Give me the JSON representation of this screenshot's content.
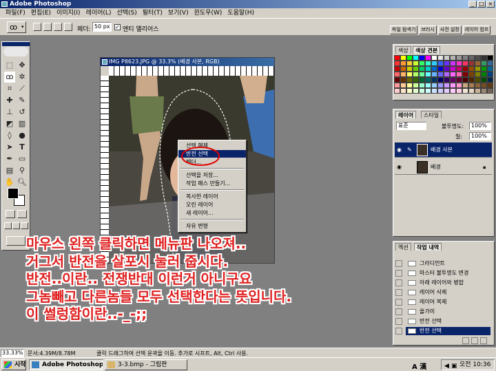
{
  "app": {
    "title": "Adobe Photoshop",
    "window_buttons": [
      "_",
      "□",
      "×"
    ]
  },
  "menubar": [
    "파일(F)",
    "편집(E)",
    "이미지(I)",
    "레이어(L)",
    "선택(S)",
    "필터(T)",
    "보기(V)",
    "윈도우(W)",
    "도움말(H)"
  ],
  "options_bar": {
    "feather_label": "페더:",
    "feather_value": "50 px",
    "antialias_label": "앤티 앨리어스",
    "antialias_checked": "✓",
    "palette_well_tabs": [
      "파일 탐색기",
      "브러시",
      "사전 설정",
      "레이어 컴프"
    ]
  },
  "document": {
    "title": "IMG P8623.JPG @ 33.3% (배경 사본, RGB)"
  },
  "context_menu": {
    "items": [
      "선택 해제",
      "반전 선택",
      "페더...",
      "선택을 저장...",
      "작업 패스 만들기...",
      "복사한 레이어",
      "오린 레이어",
      "새 레이어...",
      "자유 변형"
    ],
    "highlighted": "반전 선택"
  },
  "color_panel": {
    "tabs": [
      "색상",
      "색상 견본"
    ]
  },
  "swatch_colors": [
    "#ff0000",
    "#ffff00",
    "#00ff00",
    "#00ffff",
    "#0000ff",
    "#ff00ff",
    "#ffffff",
    "#e6e6e6",
    "#cccccc",
    "#b3b3b3",
    "#999999",
    "#808080",
    "#666666",
    "#4d4d4d",
    "#333333",
    "#000000",
    "#ff3333",
    "#ff9933",
    "#ffcc33",
    "#ccff33",
    "#33ff66",
    "#33ffcc",
    "#33ccff",
    "#3366ff",
    "#6633ff",
    "#cc33ff",
    "#ff33cc",
    "#ff3366",
    "#993333",
    "#996633",
    "#339966",
    "#336699",
    "#cc0000",
    "#cc6600",
    "#cccc00",
    "#66cc00",
    "#00cc66",
    "#00cccc",
    "#0066cc",
    "#0000cc",
    "#6600cc",
    "#cc00cc",
    "#cc0066",
    "#990000",
    "#994d00",
    "#999900",
    "#009900",
    "#006699",
    "#ff6666",
    "#ffb366",
    "#ffff66",
    "#b3ff66",
    "#66ff99",
    "#66ffff",
    "#66b3ff",
    "#6666ff",
    "#b366ff",
    "#ff66ff",
    "#ff66b3",
    "#800000",
    "#804000",
    "#808000",
    "#008000",
    "#004080",
    "#660000",
    "#663300",
    "#666600",
    "#336600",
    "#006633",
    "#006666",
    "#003366",
    "#000066",
    "#330066",
    "#660066",
    "#660033",
    "#4d0000",
    "#4d2600",
    "#4d4d00",
    "#004d00",
    "#00264d",
    "#ff9999",
    "#ffcc99",
    "#ffff99",
    "#ccff99",
    "#99ffcc",
    "#99ffff",
    "#99ccff",
    "#9999ff",
    "#cc99ff",
    "#ff99ff",
    "#ff99cc",
    "#c8a882",
    "#a67c52",
    "#8c6239",
    "#754c24",
    "#603913",
    "#ffcccc",
    "#ffe5cc",
    "#ffffcc",
    "#e5ffcc",
    "#ccffe5",
    "#ccffff",
    "#cce5ff",
    "#ccccff",
    "#e5ccff",
    "#ffccff",
    "#ffcce5",
    "#f2e6d9",
    "#e6d5c3",
    "#c7b299",
    "#998675",
    "#736357"
  ],
  "layers_panel": {
    "tabs": [
      "레이어",
      "스타일"
    ],
    "blend_mode": "표준",
    "opacity_label": "불투명도:",
    "opacity_value": "100%",
    "fill_label": "칠:",
    "fill_value": "100%",
    "layers": [
      "배경 사본",
      "배경"
    ],
    "selected_layer": "배경 사본"
  },
  "history_panel": {
    "tabs": [
      "액션",
      "작업 내역"
    ],
    "items": [
      "그라디언트",
      "마스터 불투명도 변경",
      "아래 레이어와 병합",
      "레이어 삭제",
      "레이어 복제",
      "올가미",
      "반전 선택",
      "반전 선택"
    ],
    "selected": "반전 선택"
  },
  "overlay_text": [
    "마우스 왼쪽 클릭하면 메뉴판 나오져..",
    "거그서 반전을 살포시 눌러 줍시다.",
    "반전..이란.. 전쟁반대 이런거 아니구요",
    "그놈빼고 다른놈들 모두 선택한다는 뜻입니다.",
    "이 썰렁함이란..-_-;;"
  ],
  "status_bar": {
    "zoom": "33.33%",
    "doc_size": "문서:4.39M/8.78M",
    "hint": "클릭 드래그하여 선택 윤곽을 이동. 추가로 시프트, Alt, Ctrl 사용."
  },
  "taskbar": {
    "start_label": "시작",
    "tasks": [
      "Adobe Photoshop",
      "3-3.bmp - 그림판"
    ],
    "active_task": "Adobe Photoshop",
    "ime": "A 漢",
    "clock": "오전 10:36"
  }
}
